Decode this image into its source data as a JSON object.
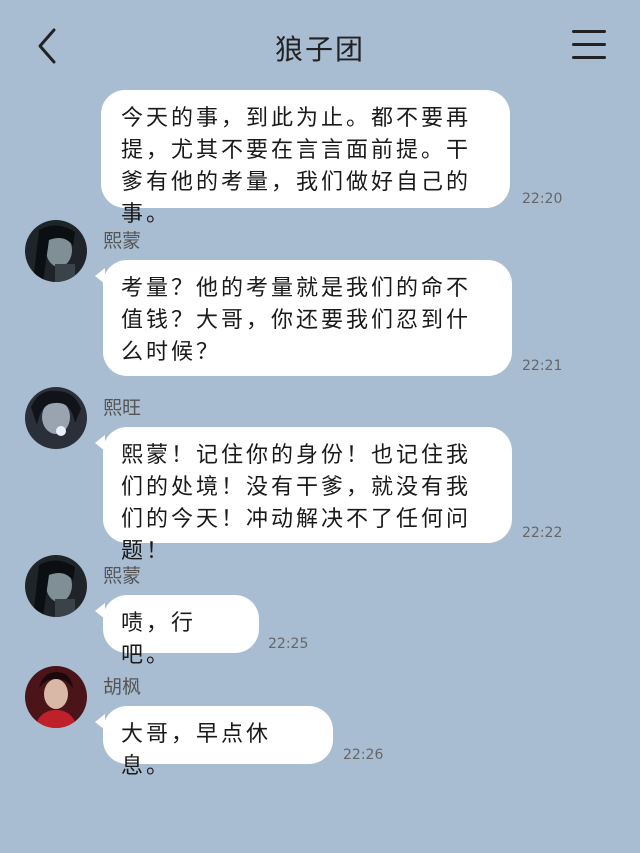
{
  "header": {
    "title": "狼子团",
    "back_icon": "chevron-left-icon",
    "menu_icon": "hamburger-menu-icon"
  },
  "messages": [
    {
      "sender": "",
      "text": "今天的事，到此为止。都不要再提，尤其不要在言言面前提。干爹有他的考量，我们做好自己的事。",
      "time": "22:20"
    },
    {
      "sender": "熙蒙",
      "text": "考量？他的考量就是我们的命不值钱？大哥，你还要我们忍到什么时候？",
      "time": "22:21"
    },
    {
      "sender": "熙旺",
      "text": "熙蒙！记住你的身份！也记住我们的处境！没有干爹，就没有我们的今天！冲动解决不了任何问题！",
      "time": "22:22"
    },
    {
      "sender": "熙蒙",
      "text": "啧，行吧。",
      "time": "22:25"
    },
    {
      "sender": "胡枫",
      "text": "大哥，早点休息。",
      "time": "22:26"
    }
  ],
  "colors": {
    "background": "#a9bdd2",
    "bubble": "#ffffff"
  }
}
